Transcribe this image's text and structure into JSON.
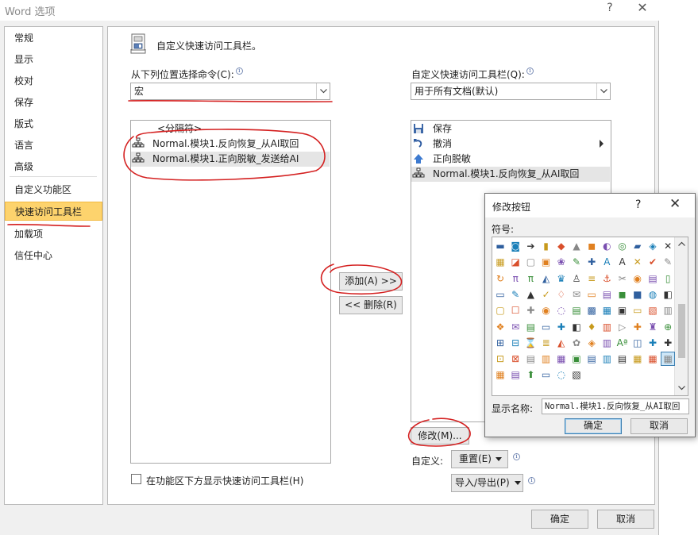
{
  "window": {
    "title": "Word 选项",
    "help": "?",
    "close": "✕"
  },
  "nav": {
    "items": [
      {
        "label": "常规",
        "name": "nav-general"
      },
      {
        "label": "显示",
        "name": "nav-display"
      },
      {
        "label": "校对",
        "name": "nav-proofing"
      },
      {
        "label": "保存",
        "name": "nav-save"
      },
      {
        "label": "版式",
        "name": "nav-typography"
      },
      {
        "label": "语言",
        "name": "nav-language"
      },
      {
        "label": "高级",
        "name": "nav-advanced"
      },
      {
        "label": "自定义功能区",
        "name": "nav-customize-ribbon"
      },
      {
        "label": "快速访问工具栏",
        "name": "nav-quick-access-toolbar"
      },
      {
        "label": "加载项",
        "name": "nav-addins"
      },
      {
        "label": "信任中心",
        "name": "nav-trust-center"
      }
    ],
    "selected_index": 8
  },
  "section": {
    "title": "自定义快速访问工具栏。"
  },
  "choose_from": {
    "label": "从下列位置选择命令(C):",
    "value": "宏"
  },
  "customize_for": {
    "label": "自定义快速访问工具栏(Q):",
    "value": "用于所有文档(默认)"
  },
  "commands_list": [
    {
      "label": "<分隔符>",
      "icon": "none"
    },
    {
      "label": "Normal.模块1.反向恢复_从AI取回",
      "icon": "macro-icon"
    },
    {
      "label": "Normal.模块1.正向脱敏_发送给AI",
      "icon": "macro-icon"
    }
  ],
  "commands_selected_index": 2,
  "toolbar_list": [
    {
      "label": "保存",
      "icon": "save-icon"
    },
    {
      "label": "撤消",
      "icon": "undo-icon"
    },
    {
      "label": "正向脱敏",
      "icon": "upload-arrow-icon"
    },
    {
      "label": "Normal.模块1.反向恢复_从AI取回",
      "icon": "macro-icon"
    }
  ],
  "toolbar_selected_index": 3,
  "buttons": {
    "add": "添加(A) >>",
    "remove": "<< 删除(R)",
    "modify": "修改(M)...",
    "reset": "重置(E)",
    "import_export": "导入/导出(P)",
    "ok": "确定",
    "cancel": "取消"
  },
  "customize_label": "自定义:",
  "show_below_ribbon": {
    "label": "在功能区下方显示快速访问工具栏(H)",
    "checked": false
  },
  "modify_dialog": {
    "title": "修改按钮",
    "help": "?",
    "close": "✕",
    "symbol_label": "符号:",
    "display_name_label": "显示名称:",
    "display_name_value": "Normal.模块1.反向恢复_从AI取回",
    "ok": "确定",
    "cancel": "取消"
  },
  "colors": {
    "nav_selected": "#fdd36d",
    "annotation_red": "#d42020",
    "accent_blue": "#3c7fb1"
  }
}
